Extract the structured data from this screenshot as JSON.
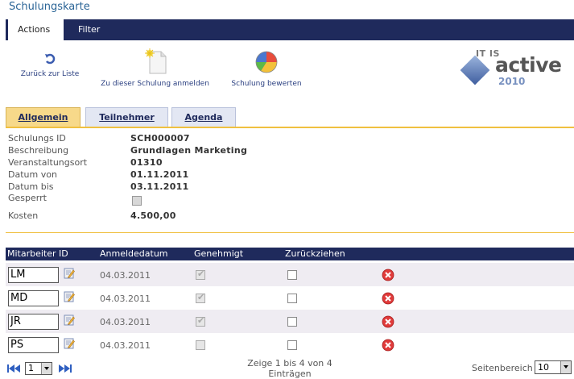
{
  "page": {
    "title": "Schulungskarte"
  },
  "nav": {
    "actions": "Actions",
    "filter": "Filter"
  },
  "toolbar": {
    "back": "Zurück zur Liste",
    "register": "Zu dieser Schulung anmelden",
    "rate": "Schulung bewerten"
  },
  "logo": {
    "line1": "IT IS",
    "line2": "active",
    "year": "2010"
  },
  "tabs": {
    "allgemein": "Allgemein",
    "teilnehmer": "Teilnehmer",
    "agenda": "Agenda"
  },
  "details": {
    "labels": [
      "Schulungs ID",
      "Beschreibung",
      "Veranstaltungsort",
      "Datum von",
      "Datum bis",
      "Gesperrt",
      "Kosten"
    ],
    "values": {
      "id": "SCH000007",
      "beschreibung": "Grundlagen Marketing",
      "ort": "01310",
      "von": "01.11.2011",
      "bis": "03.11.2011",
      "kosten": "4.500,00"
    }
  },
  "table": {
    "columns": [
      "Mitarbeiter ID",
      "Anmeldedatum",
      "Genehmigt",
      "Zurückziehen"
    ],
    "rows": [
      {
        "id": "LM",
        "date": "04.03.2011",
        "approved": true
      },
      {
        "id": "MD",
        "date": "04.03.2011",
        "approved": true
      },
      {
        "id": "JR",
        "date": "04.03.2011",
        "approved": true
      },
      {
        "id": "PS",
        "date": "04.03.2011",
        "approved": false
      }
    ]
  },
  "pager": {
    "page": "1",
    "info": "Zeige 1 bis 4 von 4 Einträgen",
    "page_size_label": "Seitenbereich",
    "page_size": "10"
  },
  "colors": {
    "navy": "#1f2a5c",
    "gold": "#f0c040",
    "link": "#2a3f80"
  }
}
